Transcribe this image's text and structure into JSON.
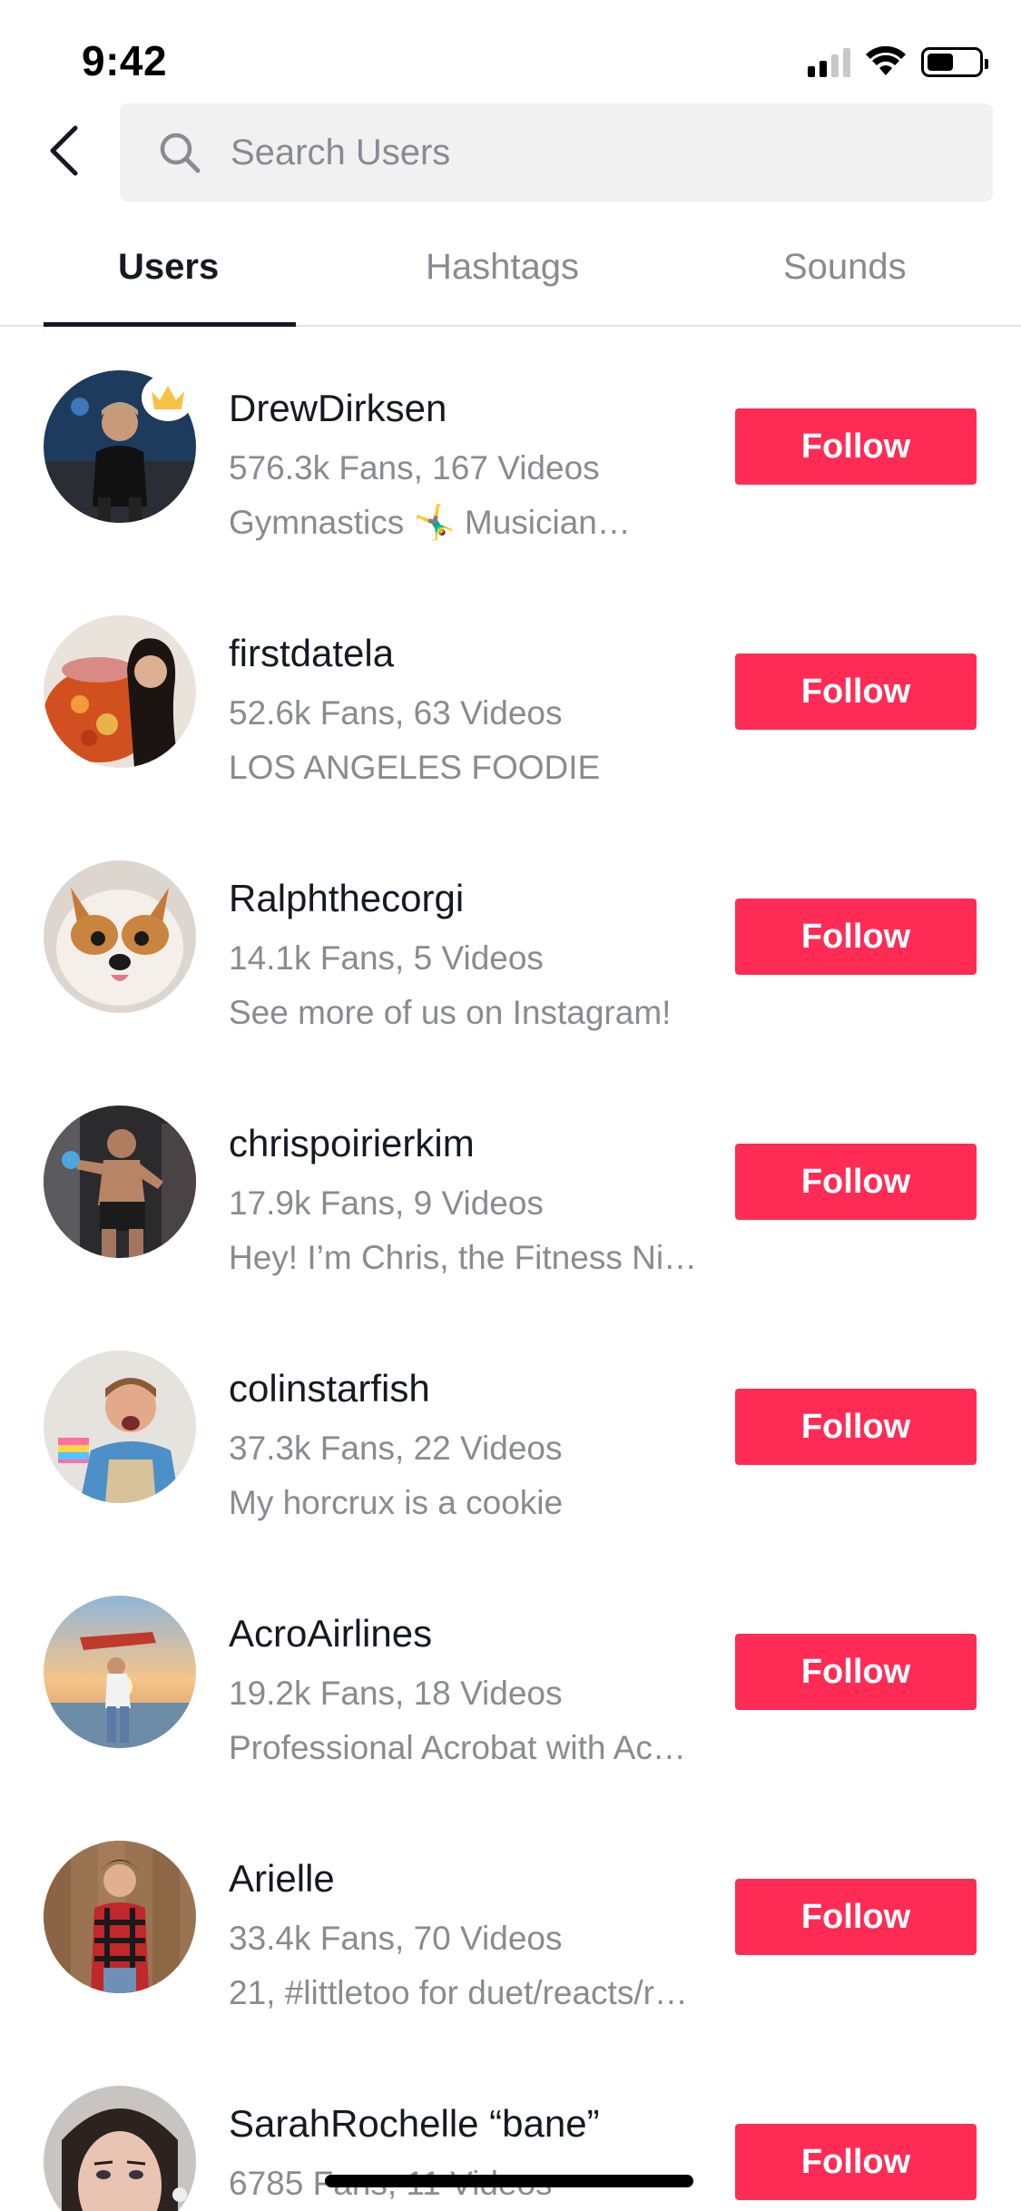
{
  "status_bar": {
    "time": "9:42"
  },
  "search": {
    "placeholder": "Search Users",
    "value": ""
  },
  "tabs": [
    {
      "label": "Users",
      "active": true
    },
    {
      "label": "Hashtags",
      "active": false
    },
    {
      "label": "Sounds",
      "active": false
    }
  ],
  "users": [
    {
      "name": "DrewDirksen",
      "stats": "576.3k Fans, 167 Videos",
      "bio": "Gymnastics 🤸‍♂️ Musician…",
      "follow_label": "Follow",
      "crown": true
    },
    {
      "name": "firstdatela",
      "stats": "52.6k Fans, 63 Videos",
      "bio": "LOS ANGELES FOODIE",
      "follow_label": "Follow"
    },
    {
      "name": "Ralphthecorgi",
      "stats": "14.1k Fans, 5 Videos",
      "bio": "See more of us on Instagram!",
      "follow_label": "Follow"
    },
    {
      "name": "chrispoirierkim",
      "stats": "17.9k Fans, 9 Videos",
      "bio": "Hey! I’m Chris, the Fitness Ni…",
      "follow_label": "Follow"
    },
    {
      "name": "colinstarfish",
      "stats": "37.3k Fans, 22 Videos",
      "bio": "My horcrux is a cookie",
      "follow_label": "Follow"
    },
    {
      "name": "AcroAirlines",
      "stats": "19.2k Fans, 18 Videos",
      "bio": "Professional Acrobat with Ac…",
      "follow_label": "Follow"
    },
    {
      "name": "Arielle",
      "stats": "33.4k Fans, 70 Videos",
      "bio": "21, #littletoo for duet/reacts/r…",
      "follow_label": "Follow"
    },
    {
      "name": "SarahRochelle “bane”",
      "stats": "6785 Fans, 11 Videos",
      "bio": "",
      "follow_label": "Follow"
    }
  ],
  "colors": {
    "accent": "#fe2c55",
    "text_primary": "#161823",
    "text_secondary": "#8a8b91",
    "search_bg": "#f1f1f2"
  },
  "icons": {
    "back": "chevron-left-icon",
    "search": "search-icon",
    "crown": "crown-icon"
  }
}
